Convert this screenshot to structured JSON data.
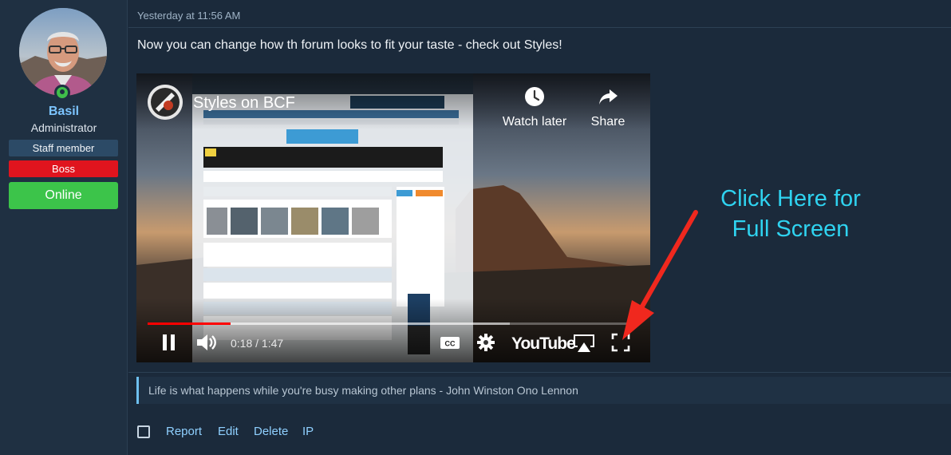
{
  "user": {
    "name": "Basil",
    "title": "Administrator",
    "banners": {
      "staff": "Staff member",
      "role": "Boss",
      "status": "Online"
    }
  },
  "post": {
    "date": "Yesterday at 11:56 AM",
    "message": "Now you can change how th forum looks to fit your taste - check out Styles!"
  },
  "video": {
    "title": "Styles on BCF",
    "actions": {
      "watch_later": "Watch later",
      "share": "Share"
    },
    "time": "0:18 / 1:47",
    "progress_played": 0.17,
    "progress_loaded": 0.74,
    "player_brand": "YouTube"
  },
  "annotation": {
    "line1": "Click Here for",
    "line2": "Full Screen",
    "color": "#2fd3f0",
    "arrow_color": "#f0281e"
  },
  "signature": "Life is what happens while you're busy making other plans - John Winston Ono Lennon",
  "post_actions": {
    "report": "Report",
    "edit": "Edit",
    "delete": "Delete",
    "ip": "IP"
  },
  "colors": {
    "background": "#1b2a3b",
    "username": "#7cc4ff",
    "boss_banner": "#e0141e",
    "online_banner": "#3cc44a",
    "link": "#8fd0ff"
  }
}
